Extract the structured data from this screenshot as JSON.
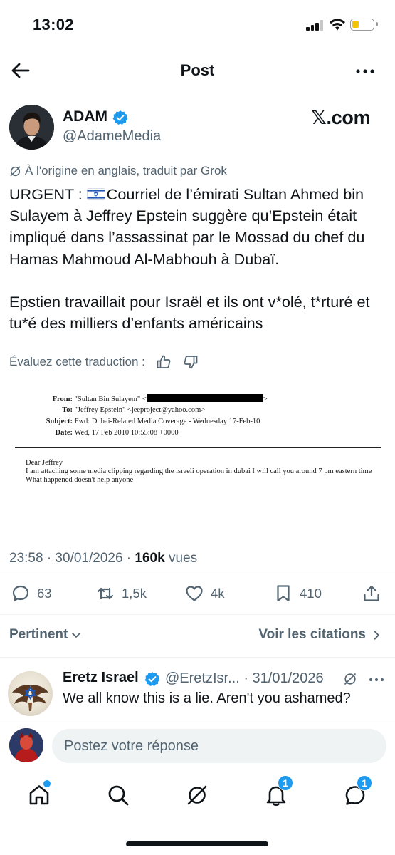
{
  "status_bar": {
    "time": "13:02"
  },
  "header": {
    "title": "Post"
  },
  "author": {
    "name": "ADAM",
    "handle": "@AdameMedia",
    "watermark": "𝕏.com"
  },
  "tweet": {
    "translated_note": "À l'origine en anglais, traduit par Grok",
    "text_prefix": "URGENT : ",
    "text_body": "Courriel de l’émirati Sultan Ahmed bin Sulayem à Jeffrey Epstein suggère qu’Epstein était impliqué dans l’assassinat par le Mossad du chef du Hamas Mahmoud Al-Mabhouh à Dubaï.\n\nEpstien travaillait pour Israël et ils ont v*olé, t*rturé et tu*é des milliers d’enfants américains",
    "rate_label": "Évaluez cette traduction :"
  },
  "email": {
    "from_label": "From:",
    "from_value": "\"Sultan Bin Sulayem\" <",
    "from_close": ">",
    "to_label": "To:",
    "to_value": "\"Jeffrey Epstein\" <jeeproject@yahoo.com>",
    "subject_label": "Subject:",
    "subject_value": "Fwd: Dubai-Related Media Coverage - Wednesday 17-Feb-10",
    "date_label": "Date:",
    "date_value": "Wed, 17 Feb 2010 10:55:08 +0000",
    "greeting": "Dear Jeffrey",
    "body_line1": "I am attaching some media clipping regarding the israeli operation in dubai I will call you around 7 pm eastern time",
    "body_line2": "What happened doesn't help anyone"
  },
  "meta": {
    "time_date": "23:58 · 30/01/2026 · ",
    "views_count": "160k",
    "views_label": " vues"
  },
  "actions": {
    "replies": "63",
    "reposts": "1,5k",
    "likes": "4k",
    "bookmarks": "410"
  },
  "filter": {
    "sort_label": "Pertinent",
    "quotes_label": "Voir les citations"
  },
  "reply": {
    "name": "Eretz Israel",
    "handle": "@EretzIsr... · 31/01/2026",
    "text": "We all know this is a lie. Aren't you ashamed?"
  },
  "composer": {
    "placeholder": "Postez votre réponse"
  },
  "nav": {
    "notifications_badge": "1",
    "messages_badge": "1"
  },
  "colors": {
    "accent": "#1d9bf0",
    "text": "#0f1419",
    "secondary": "#536471"
  }
}
